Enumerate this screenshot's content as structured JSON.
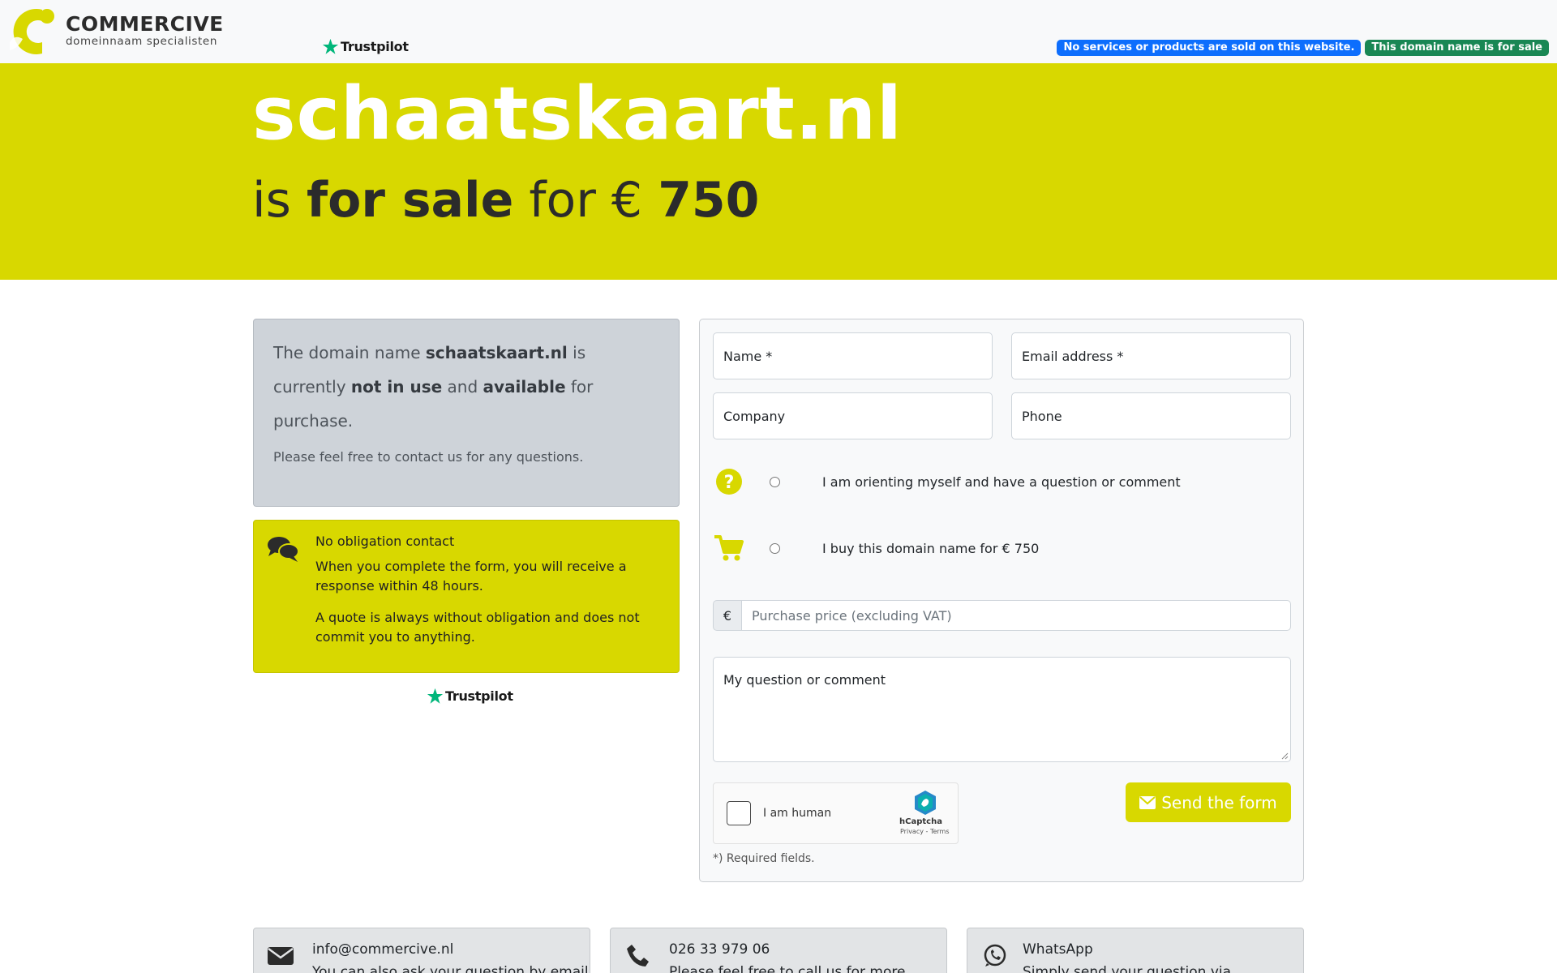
{
  "colors": {
    "accent": "#d8d800",
    "badge_info": "#0d6efd",
    "badge_sale": "#198754"
  },
  "header": {
    "brand_name": "COMMERCIVE",
    "brand_tagline": "domeinnaam specialisten",
    "trustpilot": "Trustpilot",
    "badge_no_services": "No services or products are sold on this website.",
    "badge_for_sale": "This domain name is for sale"
  },
  "hero": {
    "domain": "schaatskaart.nl",
    "is": "is",
    "for_sale": "for sale",
    "for_price": "for €",
    "price": "750"
  },
  "info": {
    "t1": "The domain name",
    "domain": "schaatskaart.nl",
    "t2": "is currently",
    "not_in_use": "not in use",
    "t3": "and",
    "available": "available",
    "t4": "for purchase.",
    "small": "Please feel free to contact us for any questions."
  },
  "contact": {
    "title": "No obligation contact",
    "p1": "When you complete the form, you will receive a response within 48 hours.",
    "p2": "A quote is always without obligation and does not commit you to anything."
  },
  "trustpilot_mid": "Trustpilot",
  "form": {
    "name": "Name *",
    "email": "Email address *",
    "company": "Company",
    "phone": "Phone",
    "option_question": "I am orienting myself and have a question or comment",
    "option_buy": "I buy this domain name for € 750",
    "currency": "€",
    "price_placeholder": "Purchase price (excluding VAT)",
    "comment_placeholder": "My question or comment",
    "captcha_label": "I am human",
    "captcha_brand": "hCaptcha",
    "captcha_links": "Privacy - Terms",
    "send": "Send the form",
    "required_note": "*) Required fields."
  },
  "footer": [
    {
      "title": "info@commercive.nl",
      "sub": "You can also ask your question by email"
    },
    {
      "title": "026 33 979 06",
      "sub": "Please feel free to call us for more"
    },
    {
      "title": "WhatsApp",
      "sub": "Simply send your question via"
    }
  ]
}
